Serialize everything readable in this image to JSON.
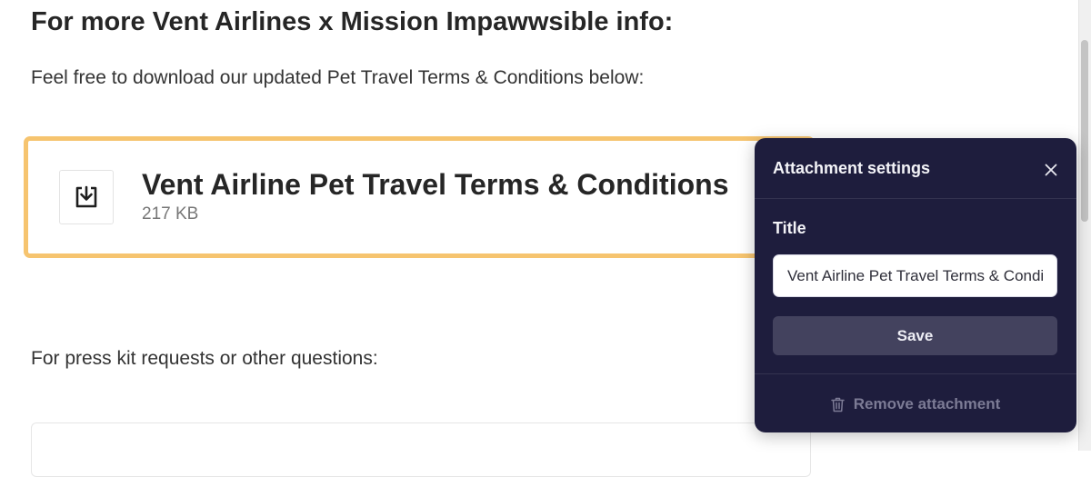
{
  "page": {
    "heading": "For more Vent Airlines x Mission Impawwsible info:",
    "download_intro": "Feel free to download our updated Pet Travel Terms & Conditions below:",
    "press_intro": "For press kit requests or other questions:"
  },
  "attachment": {
    "title": "Vent Airline Pet Travel Terms & Conditions",
    "size": "217 KB",
    "icon": "download-icon",
    "highlight_color": "#f6c46f"
  },
  "settings_panel": {
    "title": "Attachment settings",
    "close_icon": "close-icon",
    "field_label": "Title",
    "title_value": "Vent Airline Pet Travel Terms & Conditions",
    "save_label": "Save",
    "remove_label": "Remove attachment",
    "remove_icon": "trash-icon",
    "background_color": "#1e1d3d",
    "button_color": "#43425e"
  }
}
